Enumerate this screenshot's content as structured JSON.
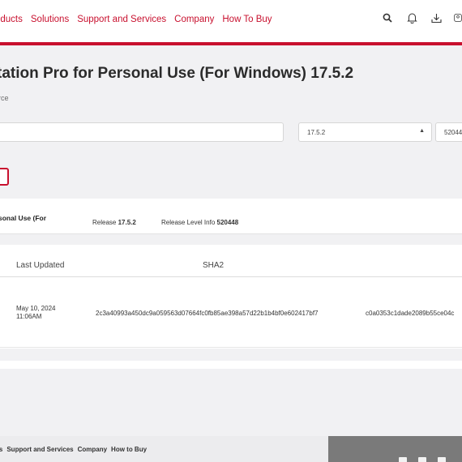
{
  "nav": {
    "links": [
      "oducts",
      "Solutions",
      "Support and Services",
      "Company",
      "How To Buy"
    ],
    "icons": [
      "search-icon",
      "bell-icon",
      "download-icon",
      "user-icon"
    ]
  },
  "colors": {
    "brand": "#c8102e",
    "background": "#f1f1f3"
  },
  "page": {
    "title": "tation Pro for Personal Use (For Windows) 17.5.2",
    "subtitle": "rce"
  },
  "filters": {
    "search_placeholder": "",
    "version_value": "17.5.2",
    "build_value": "52044",
    "chip_label": ")"
  },
  "product_info": {
    "name": "sonal Use (For",
    "release_label": "Release",
    "release_value": "17.5.2",
    "level_label": "Release Level Info",
    "level_value": "520448"
  },
  "table": {
    "headers": [
      "Last Updated",
      "SHA2"
    ],
    "rows": [
      {
        "last_updated": "May 10, 2024\n11:06AM",
        "sha2": "2c3a40993a450dc9a059563d07664fc0fb85ae398a57d22b1b4bf0e602417bf7",
        "extra": "c0a0353c1dade2089b55ce04c"
      }
    ]
  },
  "footer": {
    "links": [
      "ns",
      "Support and Services",
      "Company",
      "How to Buy"
    ]
  }
}
